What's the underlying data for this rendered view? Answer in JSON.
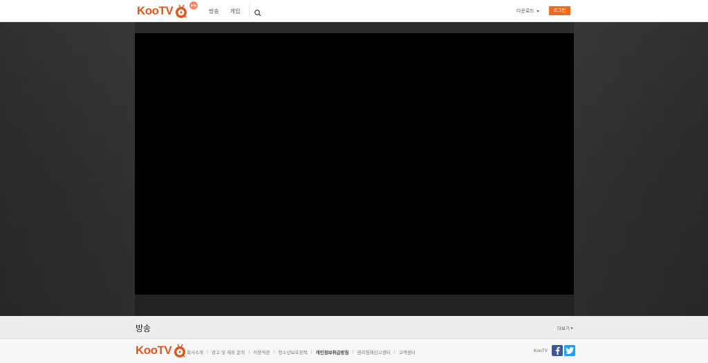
{
  "header": {
    "logo_text": "KooTV",
    "logo_badge": "beta",
    "nav": [
      {
        "label": "방송"
      },
      {
        "label": "게임"
      }
    ],
    "search_icon": "search-icon",
    "download_label": "다운로드",
    "login_label": "로그인"
  },
  "section": {
    "title": "방송",
    "more_label": "더보기"
  },
  "footer": {
    "logo_text": "KooTV",
    "links": [
      {
        "label": "회사소개"
      },
      {
        "label": "광고 및 제휴 문의"
      },
      {
        "label": "이용약관"
      },
      {
        "label": "청소년보호정책"
      },
      {
        "label": "개인정보취급방침"
      },
      {
        "label": "권리침해신고센터"
      },
      {
        "label": "고객센터"
      }
    ],
    "brand_label": "KooTV",
    "social": [
      "facebook-icon",
      "twitter-icon"
    ]
  },
  "colors": {
    "accent": "#f06a1e",
    "logo": "#e2561c",
    "stage": "#262626",
    "player": "#000000"
  }
}
